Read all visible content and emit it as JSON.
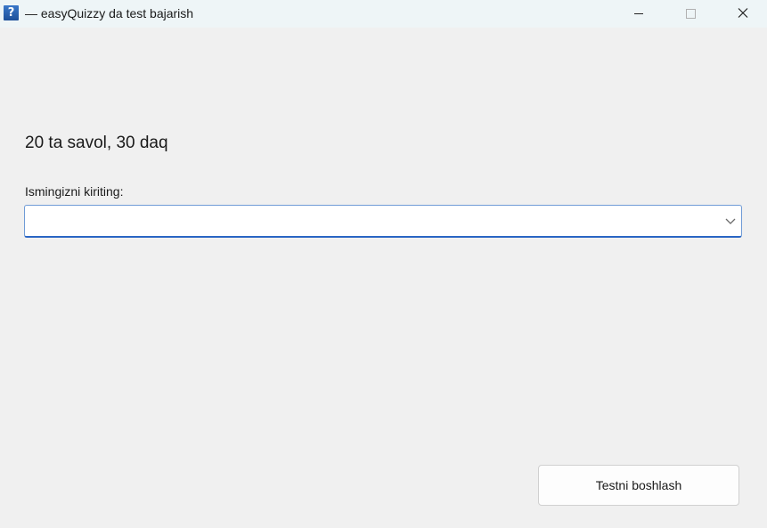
{
  "window": {
    "title": "— easyQuizzy da test bajarish",
    "app_icon_glyph": "?",
    "app_icon": "question-mark-icon"
  },
  "titlebar_buttons": {
    "minimize": "minimize-icon",
    "maximize": "maximize-icon",
    "close": "close-icon"
  },
  "main": {
    "info": "20 ta savol, 30 daq",
    "name_label": "Ismingizni kiriting:",
    "name_value": "",
    "name_placeholder": "",
    "start_button_label": "Testni boshlash"
  },
  "colors": {
    "background": "#f0f0f0",
    "titlebar": "#eef5f7",
    "accent": "#2a66c4"
  }
}
